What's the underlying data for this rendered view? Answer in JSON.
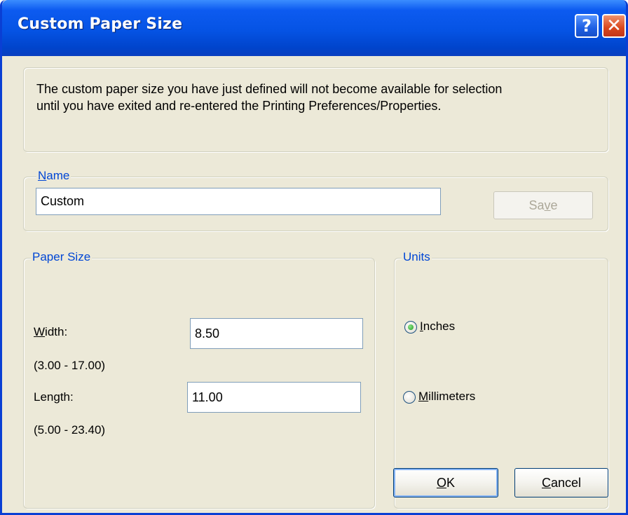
{
  "window": {
    "title": "Custom Paper Size",
    "help_glyph": "?",
    "close_glyph": "✕"
  },
  "message": {
    "line1": "The custom paper size you have just defined will not become available for selection",
    "line2": "until you have exited and re-entered the Printing Preferences/Properties."
  },
  "name_group": {
    "legend_mnemonic": "N",
    "legend_rest": "ame",
    "value": "Custom",
    "save_pre": "Sa",
    "save_mnemonic": "v",
    "save_post": "e",
    "save_enabled": false
  },
  "paper_size": {
    "legend": "Paper Size",
    "width_label_mnemonic": "W",
    "width_label_rest": "idth:",
    "width_value": "8.50",
    "width_range": "(3.00 - 17.00)",
    "length_label": "Length:",
    "length_value": "11.00",
    "length_range": "(5.00 - 23.40)"
  },
  "units": {
    "legend": "Units",
    "inches_mnemonic": "I",
    "inches_rest": "nches",
    "millimeters_mnemonic": "M",
    "millimeters_rest": "illimeters",
    "selected": "Inches"
  },
  "buttons": {
    "ok_mnemonic": "O",
    "ok_rest": "K",
    "cancel_mnemonic": "C",
    "cancel_rest": "ancel"
  },
  "colors": {
    "titlebar": "#0553e4",
    "face": "#ece9d8",
    "legend_text": "#0046d5",
    "close_button": "#d9471c"
  },
  "icons": {
    "help": "question-mark-icon",
    "close": "close-x-icon"
  }
}
